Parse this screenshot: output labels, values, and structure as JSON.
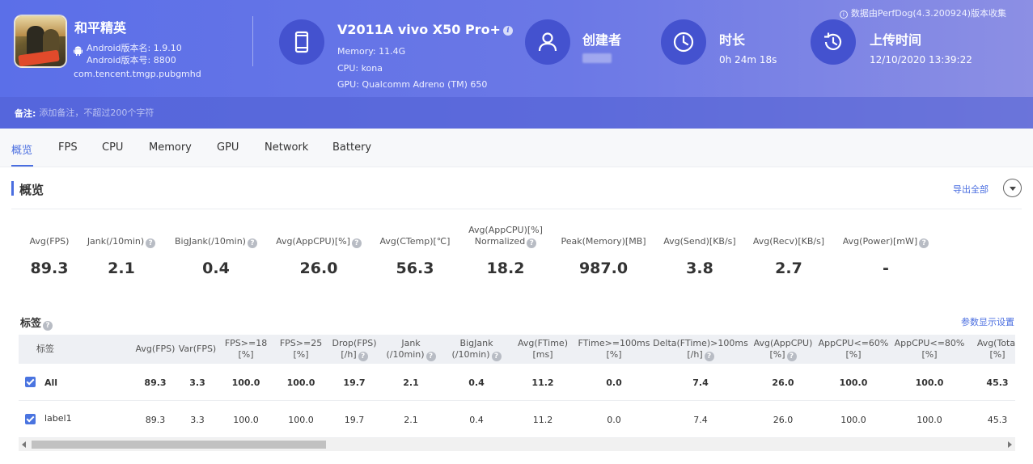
{
  "app": {
    "name": "和平精英",
    "version_name": "Android版本名: 1.9.10",
    "version_code": "Android版本号: 8800",
    "package": "com.tencent.tmgp.pubgmhd",
    "icon": "game-icon"
  },
  "device": {
    "name": "V2011A vivo X50 Pro+",
    "memory": "Memory: 11.4G",
    "cpu": "CPU: kona",
    "gpu": "GPU: Qualcomm Adreno (TM) 650",
    "icon": "phone-icon"
  },
  "creator": {
    "title": "创建者",
    "icon": "user-icon"
  },
  "duration": {
    "title": "时长",
    "value": "0h 24m 18s",
    "icon": "clock-icon"
  },
  "upload": {
    "title": "上传时间",
    "value": "12/10/2020 13:39:22",
    "icon": "history-icon"
  },
  "source_note": "数据由PerfDog(4.3.200924)版本收集",
  "remark": {
    "label": "备注:",
    "placeholder": "添加备注，不超过200个字符"
  },
  "tabs": [
    {
      "label": "概览",
      "active": true
    },
    {
      "label": "FPS"
    },
    {
      "label": "CPU"
    },
    {
      "label": "Memory"
    },
    {
      "label": "GPU"
    },
    {
      "label": "Network"
    },
    {
      "label": "Battery"
    }
  ],
  "overview": {
    "title": "概览",
    "export_label": "导出全部",
    "metrics": [
      {
        "label": "Avg(FPS)",
        "value": "89.3"
      },
      {
        "label": "Jank(/10min)",
        "value": "2.1"
      },
      {
        "label": "BigJank(/10min)",
        "value": "0.4"
      },
      {
        "label": "Avg(AppCPU)[%]",
        "value": "26.0"
      },
      {
        "label": "Avg(CTemp)[℃]",
        "value": "56.3"
      },
      {
        "label": "Avg(AppCPU)[%]",
        "label2": "Normalized",
        "value": "18.2"
      },
      {
        "label": "Peak(Memory)[MB]",
        "value": "987.0"
      },
      {
        "label": "Avg(Send)[KB/s]",
        "value": "3.8"
      },
      {
        "label": "Avg(Recv)[KB/s]",
        "value": "2.7"
      },
      {
        "label": "Avg(Power)[mW]",
        "value": "-"
      }
    ]
  },
  "labels_section": {
    "title": "标签",
    "param_link": "参数显示设置",
    "columns": [
      {
        "l1": "标签",
        "l2": ""
      },
      {
        "l1": "Avg(FPS)",
        "l2": ""
      },
      {
        "l1": "Var(FPS)",
        "l2": ""
      },
      {
        "l1": "FPS>=18",
        "l2": "[%]"
      },
      {
        "l1": "FPS>=25",
        "l2": "[%]"
      },
      {
        "l1": "Drop(FPS)",
        "l2": "[/h]"
      },
      {
        "l1": "Jank",
        "l2": "(/10min)"
      },
      {
        "l1": "BigJank",
        "l2": "(/10min)"
      },
      {
        "l1": "Avg(FTime)",
        "l2": "[ms]"
      },
      {
        "l1": "FTime>=100ms",
        "l2": "[%]"
      },
      {
        "l1": "Delta(FTime)>100ms",
        "l2": "[/h]"
      },
      {
        "l1": "Avg(AppCPU)",
        "l2": "[%]"
      },
      {
        "l1": "AppCPU<=60%",
        "l2": "[%]"
      },
      {
        "l1": "AppCPU<=80%",
        "l2": "[%]"
      },
      {
        "l1": "Avg(Total",
        "l2": "[%]"
      }
    ],
    "rows": [
      {
        "name": "All",
        "cells": [
          "89.3",
          "3.3",
          "100.0",
          "100.0",
          "19.7",
          "2.1",
          "0.4",
          "11.2",
          "0.0",
          "7.4",
          "26.0",
          "100.0",
          "100.0",
          "45.3"
        ]
      },
      {
        "name": "label1",
        "cells": [
          "89.3",
          "3.3",
          "100.0",
          "100.0",
          "19.7",
          "2.1",
          "0.4",
          "11.2",
          "0.0",
          "7.4",
          "26.0",
          "100.0",
          "100.0",
          "45.3"
        ]
      }
    ]
  },
  "colors": {
    "accent": "#4a6ee0",
    "header_start": "#5b6fe8",
    "header_end": "#8c8fe4",
    "icon_circle": "#4452cf"
  }
}
